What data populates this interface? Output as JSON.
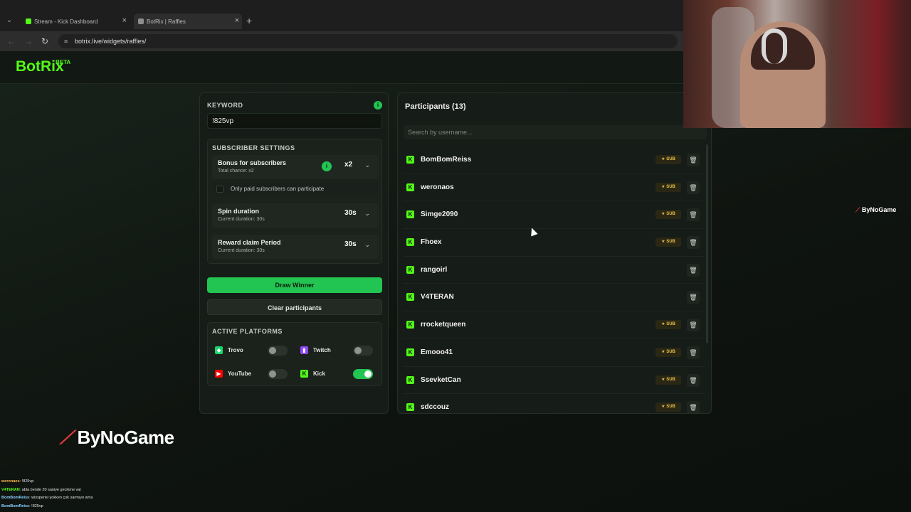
{
  "browser": {
    "tabs": [
      {
        "label": "Stream - Kick Dashboard",
        "active": false,
        "color": "#53fc18"
      },
      {
        "label": "BotRix | Raffles",
        "active": true,
        "color": "#8d8d8d"
      }
    ],
    "url": "botrix.live/widgets/raffles/"
  },
  "app": {
    "logo": "BotRix",
    "logo_badge": "BETA"
  },
  "keyword": {
    "label": "KEYWORD",
    "value": "!825vp"
  },
  "subscriber_settings": {
    "title": "SUBSCRIBER SETTINGS",
    "bonus": {
      "name": "Bonus for subscribers",
      "sub": "Total chance: x2",
      "value": "x2"
    },
    "only_paid_label": "Only paid subscribers can participate",
    "spin": {
      "name": "Spin duration",
      "sub": "Current duration: 30s",
      "value": "30s"
    },
    "reward": {
      "name": "Reward claim Period",
      "sub": "Current duration: 30s",
      "value": "30s"
    }
  },
  "actions": {
    "draw": "Draw Winner",
    "clear": "Clear participants"
  },
  "platforms": {
    "title": "ACTIVE PLATFORMS",
    "items": [
      {
        "name": "Trovo",
        "enabled": false,
        "color": "#19d66b"
      },
      {
        "name": "Twitch",
        "enabled": false,
        "color": "#9146ff"
      },
      {
        "name": "YouTube",
        "enabled": false,
        "color": "#ff0000"
      },
      {
        "name": "Kick",
        "enabled": true,
        "color": "#53fc18"
      }
    ]
  },
  "participants": {
    "title": "Participants (13)",
    "search_placeholder": "Search by username...",
    "sub_badge": "SUB",
    "list": [
      {
        "name": "BomBomReiss",
        "sub": true
      },
      {
        "name": "weronaos",
        "sub": true
      },
      {
        "name": "Simge2090",
        "sub": true
      },
      {
        "name": "Fhoex",
        "sub": true
      },
      {
        "name": "rangoirl",
        "sub": false
      },
      {
        "name": "V4TERAN",
        "sub": false
      },
      {
        "name": "rrocketqueen",
        "sub": true
      },
      {
        "name": "Emooo41",
        "sub": true
      },
      {
        "name": "SsevketCan",
        "sub": true
      },
      {
        "name": "sdccouz",
        "sub": true
      }
    ]
  },
  "overlay": {
    "brand": "ByNoGame",
    "chat": [
      {
        "user": "weronaos",
        "text": ": !825vp"
      },
      {
        "user": "V4TERAN",
        "text": ": abla bende 20 saniye gecikme var"
      },
      {
        "user": "BomBomReiss",
        "text": ": wisxperisi yokken çok sarmıyo ama"
      },
      {
        "user": "BomBomReiss",
        "text": ": !825vp"
      }
    ]
  }
}
